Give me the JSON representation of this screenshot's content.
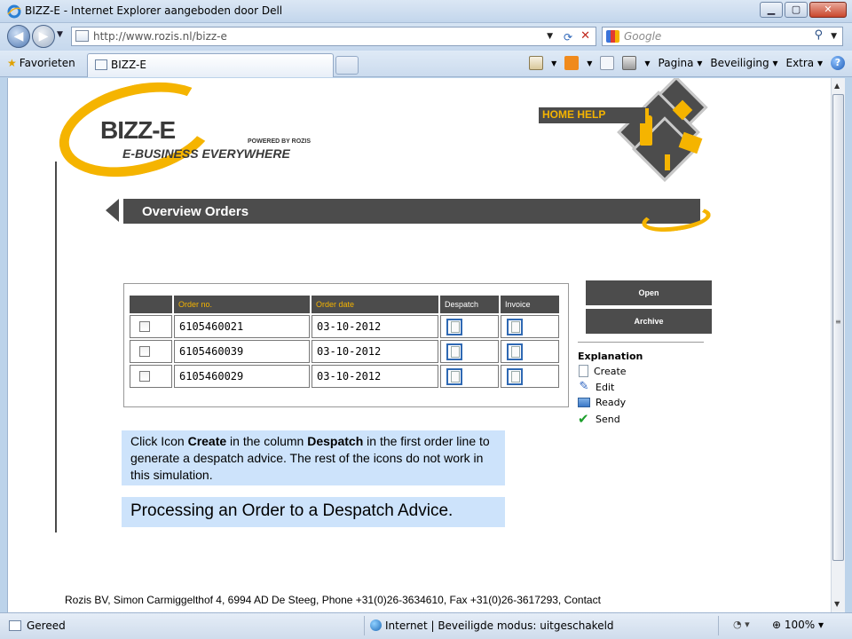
{
  "window": {
    "title": "BIZZ-E - Internet Explorer aangeboden door Dell",
    "minimize": "▁",
    "maximize": "▢",
    "close": "✕"
  },
  "address": {
    "url": "http://www.rozis.nl/bizz-e",
    "search_placeholder": "Google"
  },
  "favorites": {
    "label": "Favorieten",
    "tab_title": "BIZZ-E"
  },
  "commandbar": {
    "pagina": "Pagina ▾",
    "beveiliging": "Beveiliging ▾",
    "extra": "Extra ▾"
  },
  "page": {
    "logo": {
      "main": "BIZZ-E",
      "sub": "E-BUSINESS EVERYWHERE",
      "powered": "POWERED BY ROZIS"
    },
    "home_help": "HOME HELP",
    "header_title": "Overview Orders",
    "orders": {
      "columns": [
        "",
        "Order no.",
        "Order date",
        "Despatch",
        "Invoice"
      ],
      "rows": [
        {
          "order_no": "6105460021",
          "order_date": "03-10-2012"
        },
        {
          "order_no": "6105460039",
          "order_date": "03-10-2012"
        },
        {
          "order_no": "6105460029",
          "order_date": "03-10-2012"
        }
      ]
    },
    "buttons": {
      "open": "Open",
      "archive": "Archive"
    },
    "explanation": {
      "title": "Explanation",
      "items": [
        "Create",
        "Edit",
        "Ready",
        "Send"
      ]
    },
    "note": {
      "pre1": "Click Icon ",
      "bold1": "Create",
      "mid": " in the column ",
      "bold2": "Despatch",
      "post": " in the first order line to generate a despatch advice. The rest of the icons do not work in this simulation.",
      "caption": "Processing an Order to a Despatch Advice."
    },
    "footer": "Rozis BV, Simon Carmiggelthof 4, 6994 AD De Steeg, Phone +31(0)26-3634610, Fax +31(0)26-3617293, Contact"
  },
  "status": {
    "text": "Gereed",
    "zone": "Internet | Beveiligde modus: uitgeschakeld",
    "zoom": "100%  ▾"
  },
  "colors": {
    "brand_yellow": "#f5b400",
    "brand_dark": "#4c4c4c",
    "note_bg": "#cde3fb"
  }
}
